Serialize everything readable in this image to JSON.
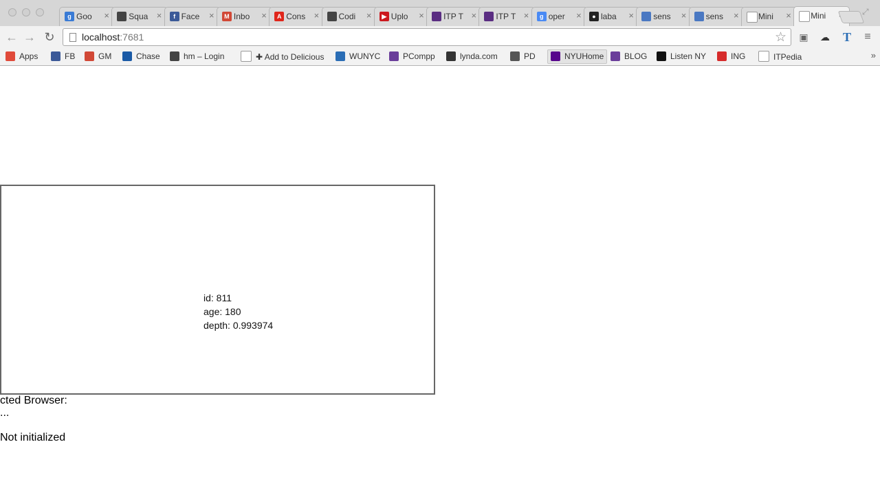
{
  "browser": {
    "tabs": [
      {
        "title": "Goo",
        "favicon": "google-icon",
        "color": "#3a7bd5",
        "glyph": "g"
      },
      {
        "title": "Squa",
        "favicon": "hand-icon",
        "color": "#444444",
        "glyph": ""
      },
      {
        "title": "Face",
        "favicon": "facebook-icon",
        "color": "#3b5998",
        "glyph": "f"
      },
      {
        "title": "Inbo",
        "favicon": "gmail-icon",
        "color": "#d14836",
        "glyph": "M"
      },
      {
        "title": "Cons",
        "favicon": "acrobat-icon",
        "color": "#e0261b",
        "glyph": "A"
      },
      {
        "title": "Codi",
        "favicon": "hand-icon",
        "color": "#444444",
        "glyph": ""
      },
      {
        "title": "Uplo",
        "favicon": "youtube-icon",
        "color": "#cc181e",
        "glyph": "▶"
      },
      {
        "title": "ITP T",
        "favicon": "itp-icon",
        "color": "#5a2d82",
        "glyph": ""
      },
      {
        "title": "ITP T",
        "favicon": "itp-icon",
        "color": "#5a2d82",
        "glyph": ""
      },
      {
        "title": "oper",
        "favicon": "google-search-icon",
        "color": "#4a8af4",
        "glyph": "g"
      },
      {
        "title": "laba",
        "favicon": "github-icon",
        "color": "#222222",
        "glyph": "●"
      },
      {
        "title": "sens",
        "favicon": "kinect-icon",
        "color": "#4a78c2",
        "glyph": ""
      },
      {
        "title": "sens",
        "favicon": "kinect-icon",
        "color": "#4a78c2",
        "glyph": ""
      },
      {
        "title": "Mini",
        "favicon": "page-icon",
        "color": "#ffffff",
        "glyph": ""
      },
      {
        "title": "Mini",
        "favicon": "page-icon",
        "color": "#ffffff",
        "glyph": "",
        "active": true
      }
    ],
    "url_host": "localhost",
    "url_port": ":7681",
    "bookmarks": [
      {
        "label": "Apps",
        "icon": "apps-grid-icon",
        "color": "#e04a3a"
      },
      {
        "label": "FB",
        "icon": "facebook-icon",
        "color": "#3b5998"
      },
      {
        "label": "GM",
        "icon": "gmail-icon",
        "color": "#d14836"
      },
      {
        "label": "Chase",
        "icon": "chase-icon",
        "color": "#1a5aa6"
      },
      {
        "label": "hm – Login",
        "icon": "hand-icon",
        "color": "#444444"
      },
      {
        "label": "✚ Add to Delicious",
        "icon": "page-icon",
        "color": "#ffffff"
      },
      {
        "label": "WUNYC",
        "icon": "wnyc-icon",
        "color": "#2a6db5"
      },
      {
        "label": "PCompp",
        "icon": "itp-circle-icon",
        "color": "#6a3d9a"
      },
      {
        "label": "lynda.com",
        "icon": "lynda-icon",
        "color": "#333333"
      },
      {
        "label": "PD",
        "icon": "pd-icon",
        "color": "#555555"
      },
      {
        "label": "NYUHome",
        "icon": "nyu-icon",
        "color": "#57068c"
      },
      {
        "label": "BLOG",
        "icon": "itp-circle-icon",
        "color": "#6a3d9a"
      },
      {
        "label": "Listen NY",
        "icon": "listen-icon",
        "color": "#111111"
      },
      {
        "label": "ING",
        "icon": "ing-icon",
        "color": "#d62b2b"
      },
      {
        "label": "ITPedia",
        "icon": "page-icon",
        "color": "#ffffff"
      }
    ]
  },
  "user": {
    "id_line": "id: 811",
    "age_line": "age: 180",
    "depth_line": "depth: 0.993974"
  },
  "status": {
    "browser_line": "cted Browser:",
    "ellipsis_line": "...",
    "init_line": "Not initialized"
  }
}
